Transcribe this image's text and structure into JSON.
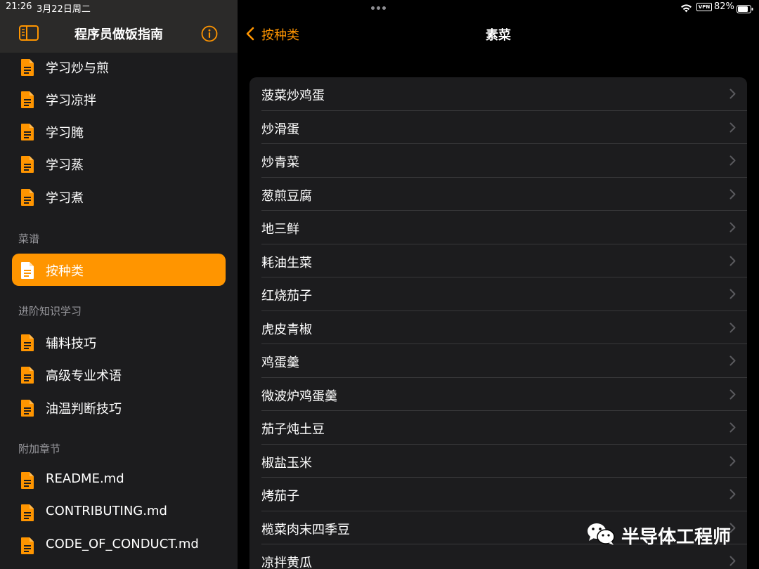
{
  "status": {
    "time": "21:26",
    "date": "3月22日周二",
    "vpn": "VPN",
    "battery": "82%"
  },
  "sidebar": {
    "title": "程序员做饭指南",
    "items_top": [
      {
        "label": "学习炒与煎"
      },
      {
        "label": "学习凉拌"
      },
      {
        "label": "学习腌"
      },
      {
        "label": "学习蒸"
      },
      {
        "label": "学习煮"
      }
    ],
    "section_recipes": "菜谱",
    "active_item": "按种类",
    "section_advanced": "进阶知识学习",
    "items_advanced": [
      {
        "label": "辅料技巧"
      },
      {
        "label": "高级专业术语"
      },
      {
        "label": "油温判断技巧"
      }
    ],
    "section_appendix": "附加章节",
    "items_appendix": [
      {
        "label": "README.md"
      },
      {
        "label": "CONTRIBUTING.md"
      },
      {
        "label": "CODE_OF_CONDUCT.md"
      }
    ]
  },
  "detail": {
    "back_label": "按种类",
    "title": "素菜",
    "rows": [
      "菠菜炒鸡蛋",
      "炒滑蛋",
      "炒青菜",
      "葱煎豆腐",
      "地三鲜",
      "耗油生菜",
      "红烧茄子",
      "虎皮青椒",
      "鸡蛋羹",
      "微波炉鸡蛋羹",
      "茄子炖土豆",
      "椒盐玉米",
      "烤茄子",
      "榄菜肉末四季豆",
      "凉拌黄瓜"
    ]
  },
  "watermark": {
    "text": "半导体工程师"
  },
  "colors": {
    "accent": "#ff9500",
    "sidebar_bg": "#1c1c1e",
    "list_bg": "#1c1c1e",
    "separator": "#38383a"
  }
}
